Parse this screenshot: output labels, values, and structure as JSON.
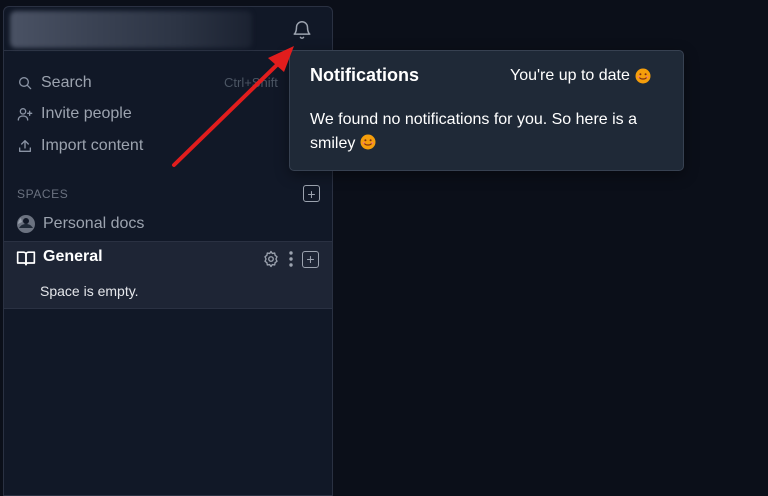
{
  "sidebar": {
    "nav": [
      {
        "label": "Search",
        "icon": "search-icon"
      },
      {
        "label": "Invite people",
        "icon": "user-plus-icon"
      },
      {
        "label": "Import content",
        "icon": "upload-icon"
      }
    ],
    "search_shortcut": "Ctrl+Shift",
    "spaces_label": "SPACES",
    "spaces": [
      {
        "label": "Personal docs",
        "icon": "avatar-icon"
      },
      {
        "label": "General",
        "icon": "book-icon"
      }
    ],
    "empty_message": "Space is empty."
  },
  "notifications": {
    "title": "Notifications",
    "status": "You're up to date",
    "body": "We found no notifications for you. So here is a smiley"
  },
  "colors": {
    "background": "#0b0f19",
    "sidebar": "#111827",
    "popover": "#1f2937",
    "active_space": "#1e2535",
    "annotation_arrow": "#e11d1d",
    "smiley": "#f59e0b"
  }
}
